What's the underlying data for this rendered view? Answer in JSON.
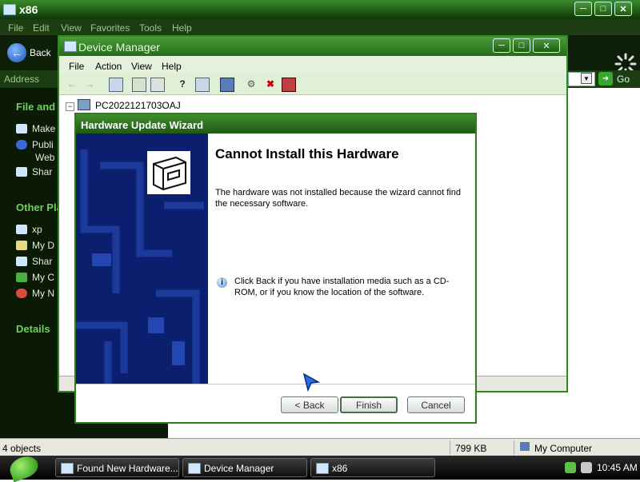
{
  "explorer": {
    "title": "x86",
    "menu": [
      "File",
      "Edit",
      "View",
      "Favorites",
      "Tools",
      "Help"
    ],
    "back_label": "Back",
    "address_label": "Address",
    "go_label": "Go",
    "left_panel": {
      "file_heading": "File and F",
      "file_items": [
        "Make",
        "Publi",
        "Web",
        "Shar"
      ],
      "other_heading": "Other Pla",
      "other_items": [
        "xp",
        "My D",
        "Shar",
        "My C",
        "My N"
      ],
      "details_heading": "Details"
    },
    "status": {
      "objects": "4 objects",
      "size": "799 KB",
      "location": "My Computer"
    }
  },
  "device_manager": {
    "title": "Device Manager",
    "menu": [
      "File",
      "Action",
      "View",
      "Help"
    ],
    "tree_root": "PC2022121703OAJ"
  },
  "wizard": {
    "title": "Hardware Update Wizard",
    "heading": "Cannot Install this Hardware",
    "message": "The hardware was not installed because the wizard cannot find the necessary software.",
    "info": "Click Back if you have installation media such as a CD-ROM, or if you know the location of the software.",
    "back_label": "< Back",
    "finish_label": "Finish",
    "cancel_label": "Cancel"
  },
  "taskbar": {
    "tasks": [
      "Found New Hardware...",
      "Device Manager",
      "x86"
    ],
    "clock": "10:45 AM"
  },
  "colors": {
    "title_green": "#256a18",
    "wizard_panel_blue": "#0c1e6e",
    "explorer_dark": "#0a1a05"
  }
}
